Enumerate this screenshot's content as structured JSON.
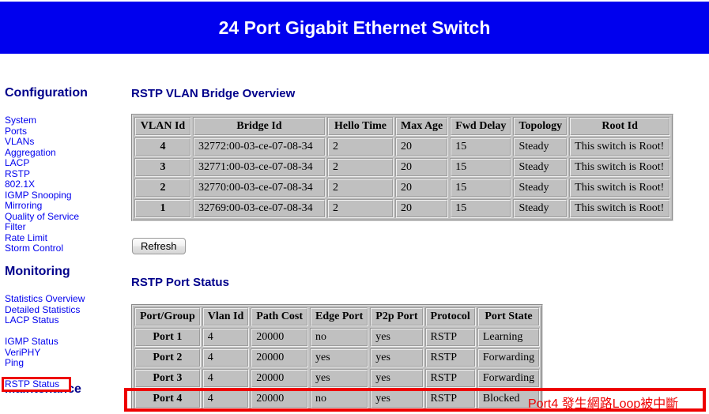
{
  "header": {
    "title": "24 Port Gigabit Ethernet Switch",
    "background_color": "#0000ee",
    "text_color": "#ffffff"
  },
  "sidebar": {
    "sections": [
      {
        "heading": "Configuration",
        "items": [
          "System",
          "Ports",
          "VLANs",
          "Aggregation",
          "LACP",
          "RSTP",
          "802.1X",
          "IGMP Snooping",
          "Mirroring",
          "Quality of Service",
          "Filter",
          "Rate Limit",
          "Storm Control"
        ]
      },
      {
        "heading": "Monitoring",
        "items": [
          "Statistics Overview",
          "Detailed Statistics",
          "LACP Status",
          "RSTP Status",
          "IGMP Status",
          "VeriPHY",
          "Ping"
        ]
      },
      {
        "heading": "Maintenance",
        "items": []
      }
    ],
    "active_item": "RSTP Status",
    "highlight_color": "#ee0000",
    "link_color": "#0000ee",
    "heading_color": "#00008b"
  },
  "main": {
    "bridge_overview": {
      "title": "RSTP VLAN Bridge Overview",
      "columns": [
        "VLAN Id",
        "Bridge Id",
        "Hello Time",
        "Max Age",
        "Fwd Delay",
        "Topology",
        "Root Id"
      ],
      "rows": [
        [
          "4",
          "32772:00-03-ce-07-08-34",
          "2",
          "20",
          "15",
          "Steady",
          "This switch is Root!"
        ],
        [
          "3",
          "32771:00-03-ce-07-08-34",
          "2",
          "20",
          "15",
          "Steady",
          "This switch is Root!"
        ],
        [
          "2",
          "32770:00-03-ce-07-08-34",
          "2",
          "20",
          "15",
          "Steady",
          "This switch is Root!"
        ],
        [
          "1",
          "32769:00-03-ce-07-08-34",
          "2",
          "20",
          "15",
          "Steady",
          "This switch is Root!"
        ]
      ]
    },
    "refresh_label": "Refresh",
    "port_status": {
      "title": "RSTP Port Status",
      "columns": [
        "Port/Group",
        "Vlan Id",
        "Path Cost",
        "Edge Port",
        "P2p Port",
        "Protocol",
        "Port State"
      ],
      "rows": [
        [
          "Port 1",
          "4",
          "20000",
          "no",
          "yes",
          "RSTP",
          "Learning"
        ],
        [
          "Port 2",
          "4",
          "20000",
          "yes",
          "yes",
          "RSTP",
          "Forwarding"
        ],
        [
          "Port 3",
          "4",
          "20000",
          "yes",
          "yes",
          "RSTP",
          "Forwarding"
        ],
        [
          "Port 4",
          "4",
          "20000",
          "no",
          "yes",
          "RSTP",
          "Blocked"
        ]
      ],
      "highlighted_row_index": 3,
      "annotation": "Port4 發生網路Loop被中斷",
      "annotation_color": "#ee0000"
    }
  }
}
